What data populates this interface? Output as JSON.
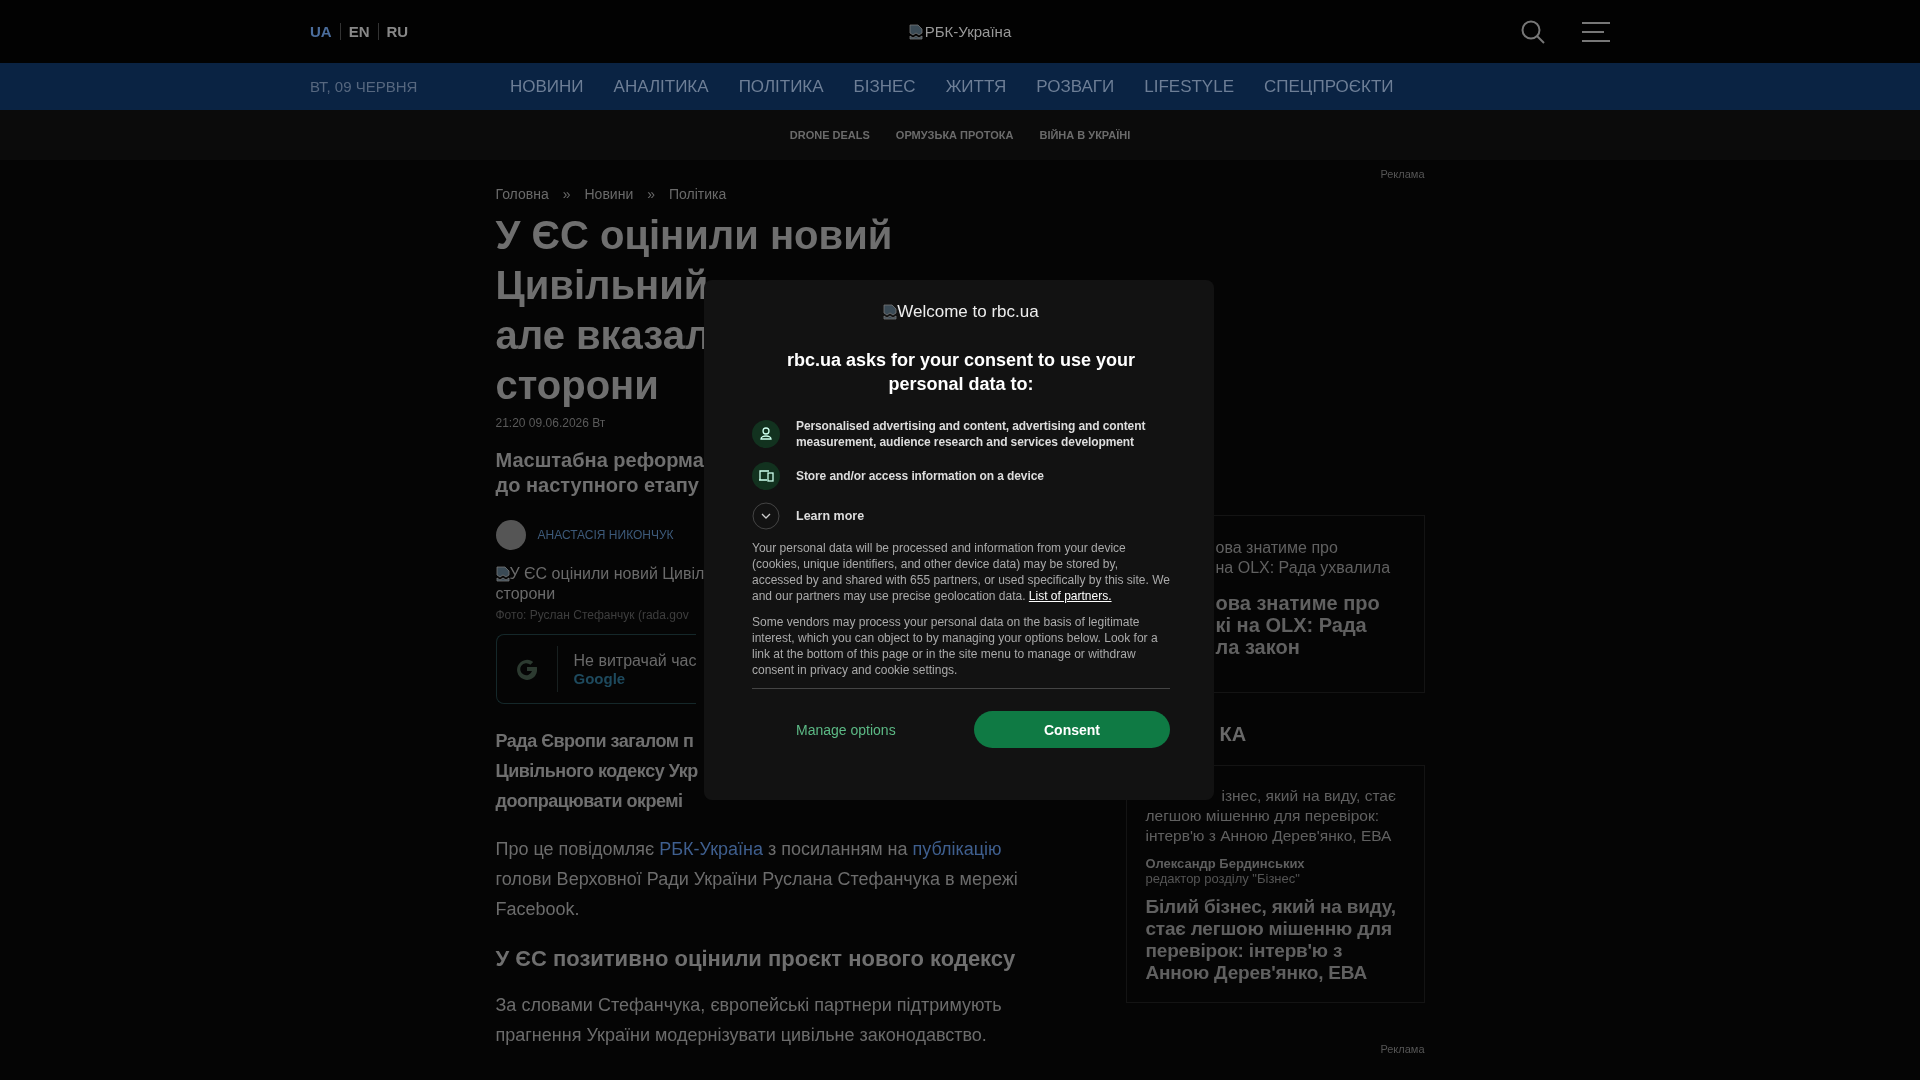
{
  "header": {
    "languages": [
      {
        "label": "UA",
        "selected": true
      },
      {
        "label": "EN",
        "selected": false
      },
      {
        "label": "RU",
        "selected": false
      }
    ],
    "logo_alt": "РБК-Україна"
  },
  "nav": {
    "date": "ВТ, 09 ЧЕРВНЯ",
    "items": [
      "НОВИНИ",
      "АНАЛІТИКА",
      "ПОЛІТИКА",
      "БІЗНЕС",
      "ЖИТТЯ",
      "РОЗВАГИ",
      "LIFESTYLE",
      "СПЕЦПРОЄКТИ"
    ],
    "subnav": [
      "DRONE DEALS",
      "ОРМУЗЬКА ПРОТОКА",
      "ВІЙНА В УКРАЇНІ"
    ]
  },
  "ad_labels": [
    "Реклама",
    "Реклама"
  ],
  "breadcrumb": {
    "separator": "»",
    "items": [
      "Головна",
      "Новини",
      "Політика"
    ]
  },
  "article": {
    "title_lines": [
      "У ЄС оцінили новий",
      "Цивільний",
      "але вказал",
      "сторони"
    ],
    "published": "21:20 09.06.2026 Вт",
    "lead_lines": [
      "Масштабна реформа",
      "до наступного етапу"
    ],
    "author": "АНАСТАСІЯ НИКОНЧУК",
    "image_alt_lines": [
      "У ЄС оцінили новий Цивіл",
      "сторони"
    ],
    "caption": "Фото: Руслан Стефанчук (rada.gov",
    "promo": {
      "text": "Не витрачай час",
      "link": "Google"
    },
    "bold_lines": [
      "Рада Європи загалом п",
      "Цивільного кодексу Укр",
      "доопрацювати окремі"
    ],
    "paragraph": [
      {
        "kind": "text",
        "text": "Про це повідомляє "
      },
      {
        "kind": "link",
        "text": "РБК-Україна"
      },
      {
        "kind": "text",
        "text": " з посиланням на "
      },
      {
        "kind": "link",
        "text": "публікацію"
      },
      {
        "kind": "text",
        "text": " голови Верховної Ради України Руслана Стефанчука в мережі Facebook."
      }
    ],
    "heading": "У ЄС позитивно оцінили проєкт нового кодексу",
    "paragraph_2": "За словами Стефанчука, європейські партнери підтримують прагнення України модернізувати цивільне законодавство."
  },
  "sidebar": {
    "card_1": {
      "summary_lines": [
        "ова знатиме про",
        "на OLX: Рада ухвалила"
      ],
      "title_lines": [
        "ова знатиме про",
        "кі на OLX: Рада",
        "ла закон"
      ]
    },
    "section_title": "КА",
    "card_2": {
      "summary_lines": [
        "ізнес, який на виду, стає",
        "легшою мішенню для перевірок:",
        "інтерв'ю з Анною Дерев'янко, ЕВА"
      ],
      "author": "Олександр Бердинських",
      "role": "редактор розділу \"Бізнес\"",
      "title": "Білий бізнес, який на виду, стає легшою мішенню для перевірок: інтерв'ю з Анною Дерев'янко, ЕВА"
    }
  },
  "consent": {
    "logo_alt": "Welcome to rbc.ua",
    "heading": "rbc.ua asks for your consent to use your personal data to:",
    "purposes": [
      {
        "kind": "person",
        "text": "Personalised advertising and content, advertising and content measurement, audience research and services development"
      },
      {
        "kind": "device",
        "text": "Store and/or access information on a device"
      }
    ],
    "learn_more": {
      "label": "Learn more",
      "expanded": false
    },
    "paragraph_1": [
      {
        "kind": "text",
        "text": "Your personal data will be processed and information from your device (cookies, unique identifiers, and other device data) may be stored by, accessed by and shared with 655 partners, or used specifically by this site. We and our partners may use precise geolocation data. "
      },
      {
        "kind": "link",
        "text": "List of partners."
      }
    ],
    "paragraph_2": "Some vendors may process your personal data on the basis of legitimate interest, which you can object to by managing your options below. Look for a link at the bottom of this page or in the site menu to manage or withdraw consent in privacy and cookie settings.",
    "buttons": {
      "manage": "Manage options",
      "consent": "Consent"
    }
  }
}
